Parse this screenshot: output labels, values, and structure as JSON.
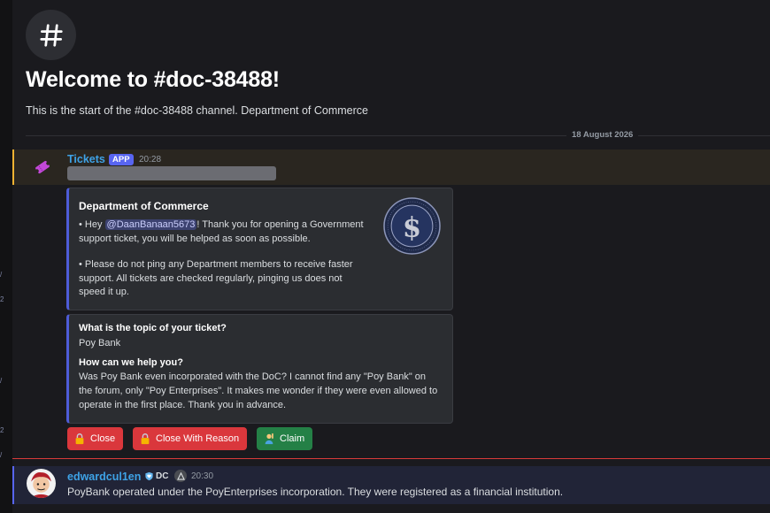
{
  "channel": {
    "icon": "hash-icon",
    "welcome_title": "Welcome to #doc-38488!",
    "welcome_subtitle": "This is the start of the #doc-38488 channel. Department of Commerce"
  },
  "divider_date": "18 August 2026",
  "bot_message": {
    "author": "Tickets",
    "badge": "APP",
    "time": "20:28",
    "avatar_icon": "ticket-icon",
    "accent_color": "#f0b232"
  },
  "embed_intro": {
    "title": "Department of Commerce",
    "line1_prefix": "• Hey ",
    "mention": "@DaanBanaan5673",
    "line1_suffix": "! Thank you for opening a Government support ticket, you will be helped as soon as possible.",
    "line2": "• Please do not ping any Department members to receive faster support. All tickets are checked regularly, pinging us does not speed it up.",
    "seal_icon": "department-seal-icon"
  },
  "embed_fields": {
    "q1": "What is the topic of your ticket?",
    "a1": "Poy Bank",
    "q2": "How can we help you?",
    "a2": "Was Poy Bank even incorporated with the DoC? I cannot find any \"Poy Bank\" on the forum, only \"Poy Enterprises\". It makes me wonder if they were even allowed to operate in the first place. Thank you in advance."
  },
  "buttons": {
    "close": "Close",
    "close_reason": "Close With Reason",
    "claim": "Claim"
  },
  "user_message": {
    "author": "edwardcul1en",
    "role_tag": "DC",
    "time": "20:30",
    "text": "PoyBank operated under the PoyEnterprises incorporation. They were registered as a financial institution."
  }
}
